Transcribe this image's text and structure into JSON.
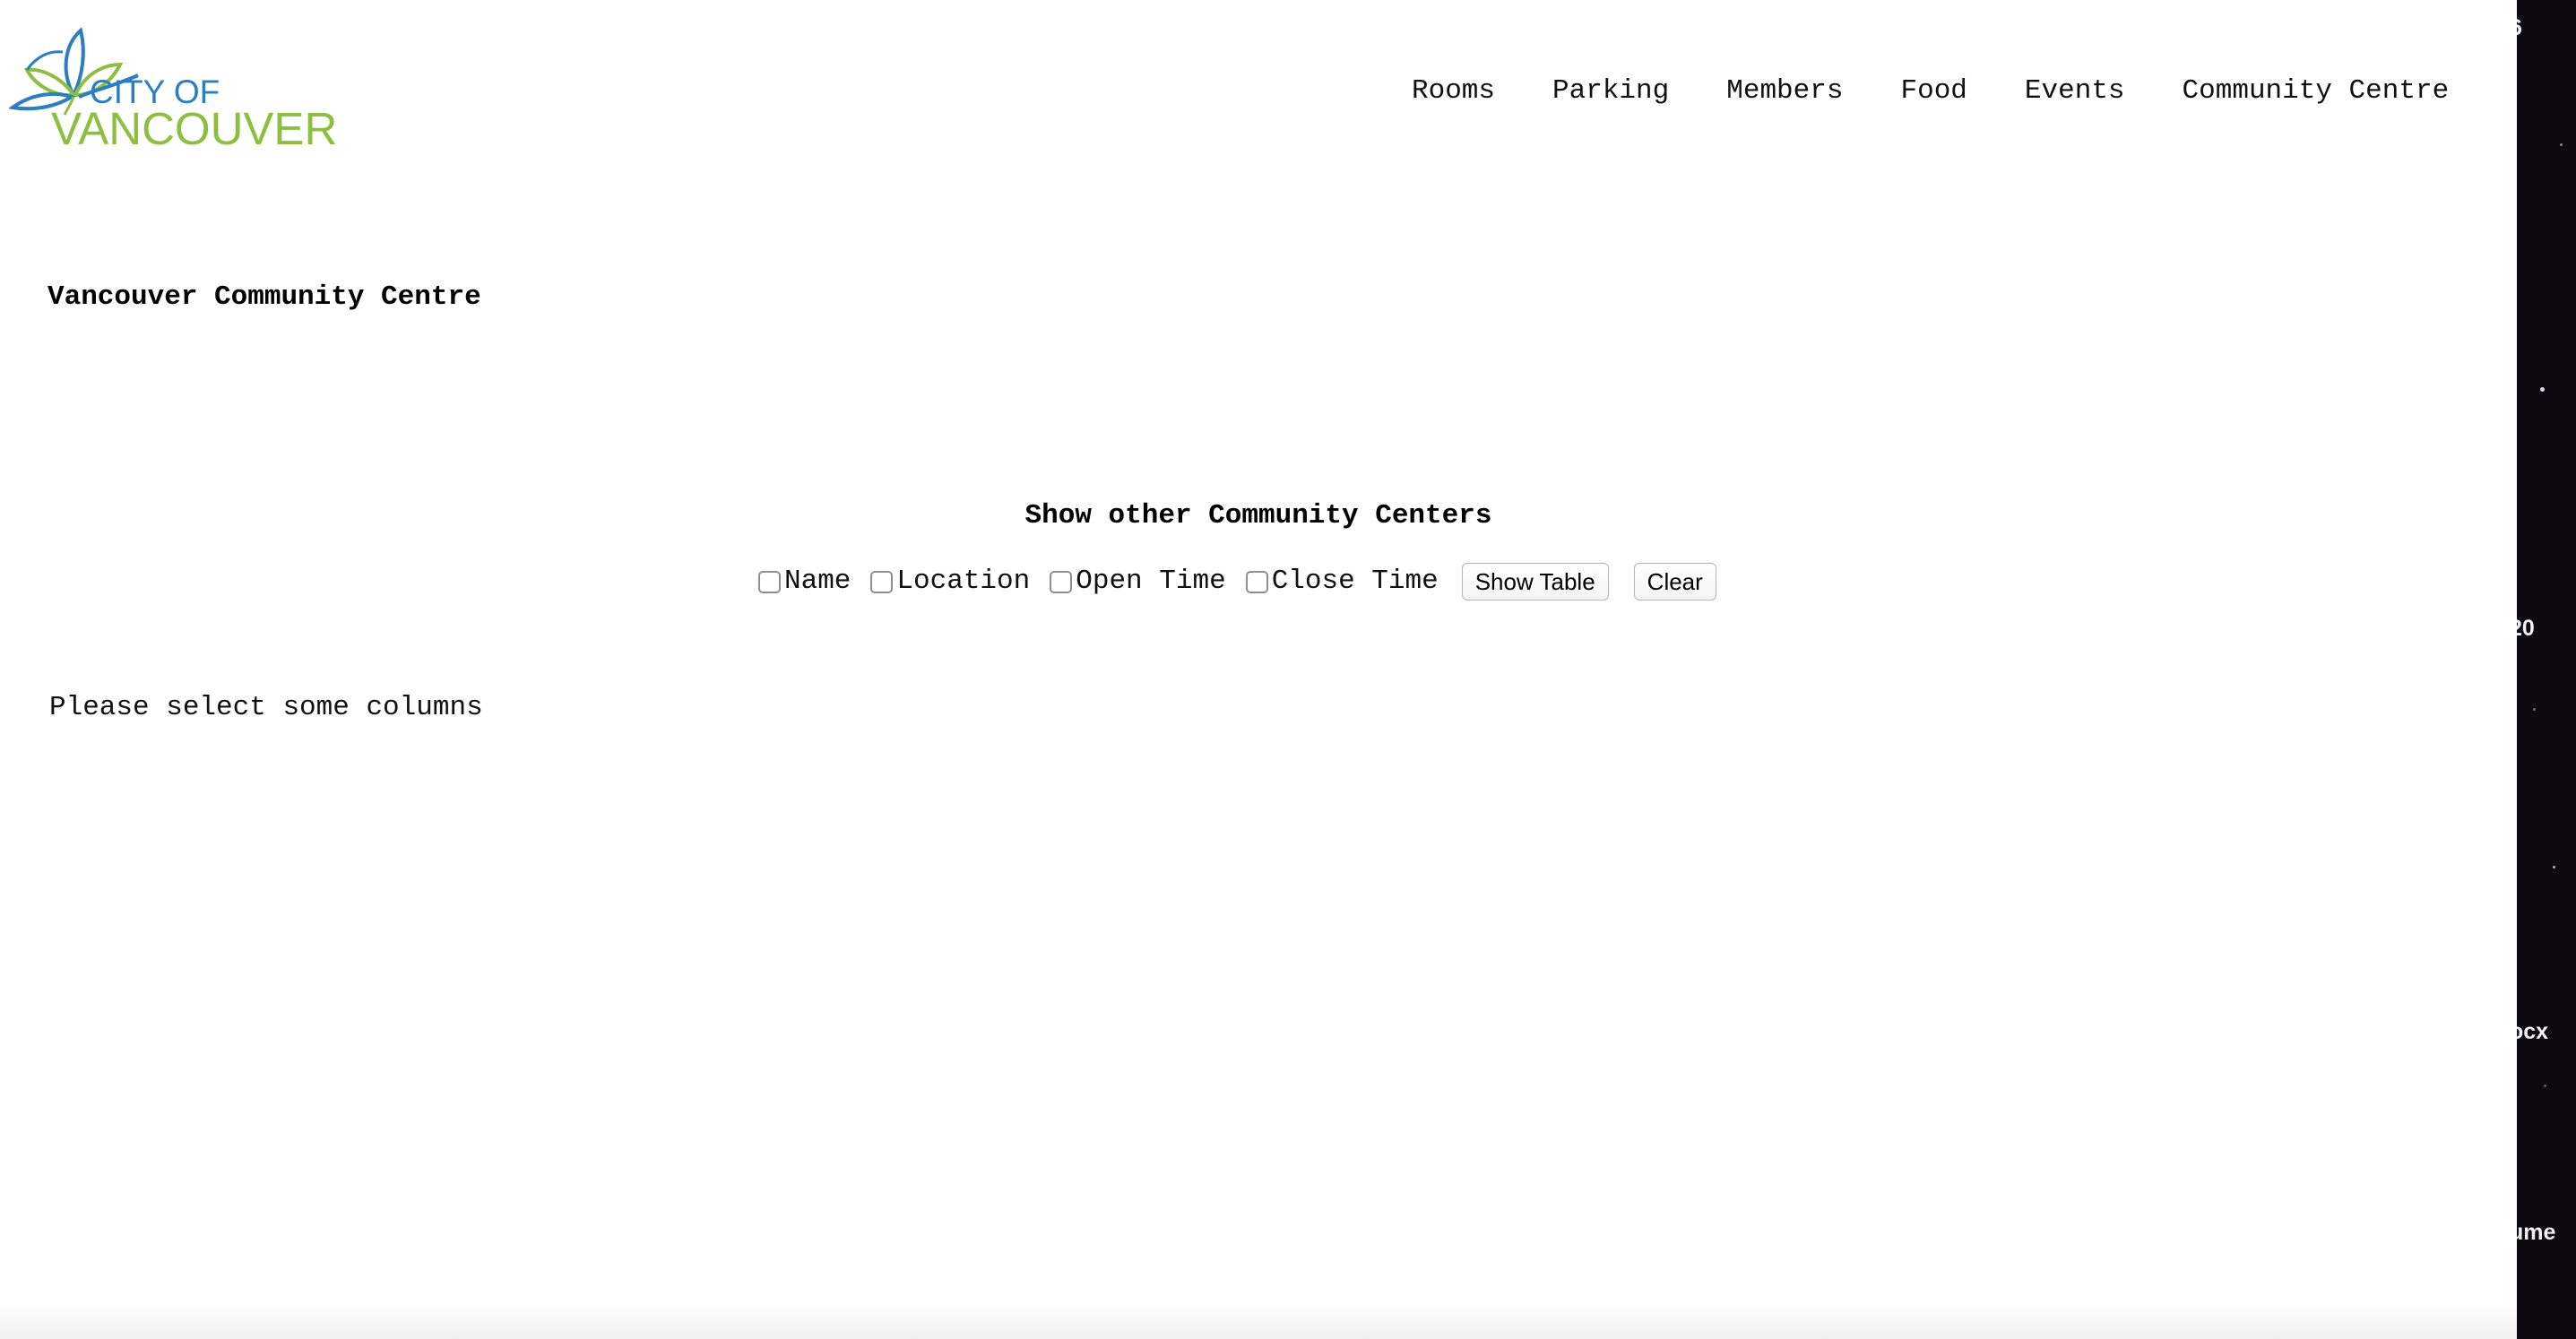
{
  "logo": {
    "line1": "CITY OF",
    "line2": "VANCOUVER",
    "colors": {
      "blue": "#2b7ec1",
      "green": "#8cbf3f"
    }
  },
  "nav": {
    "items": [
      {
        "label": "Rooms"
      },
      {
        "label": "Parking"
      },
      {
        "label": "Members"
      },
      {
        "label": "Food"
      },
      {
        "label": "Events"
      },
      {
        "label": "Community Centre"
      }
    ]
  },
  "page": {
    "title": "Vancouver Community Centre"
  },
  "section": {
    "heading": "Show other Community Centers",
    "columns": [
      {
        "label": "Name",
        "checked": false
      },
      {
        "label": "Location",
        "checked": false
      },
      {
        "label": "Open Time",
        "checked": false
      },
      {
        "label": "Close Time",
        "checked": false
      }
    ],
    "show_button": "Show Table",
    "clear_button": "Clear",
    "message": "Please select some columns"
  },
  "desktop": {
    "fragments": [
      "6",
      "20",
      "ocx",
      "ume"
    ],
    "background": "#0c0911"
  }
}
